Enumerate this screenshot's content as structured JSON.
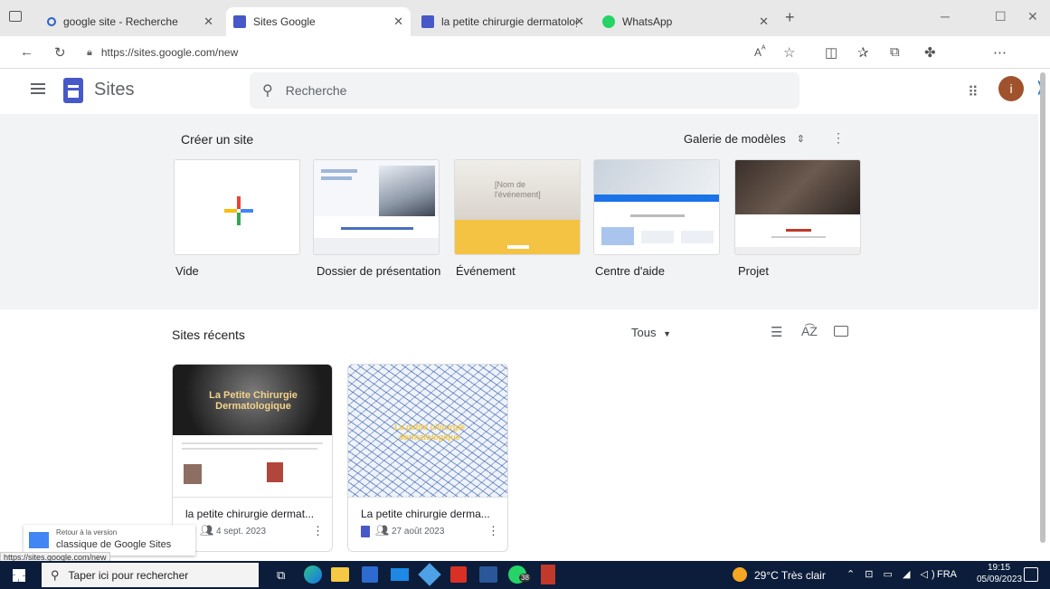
{
  "browser": {
    "tabs": [
      {
        "title": "google site - Recherche"
      },
      {
        "title": "Sites Google"
      },
      {
        "title": "la petite chirurgie dermatologiq"
      },
      {
        "title": "WhatsApp"
      }
    ],
    "url": "https://sites.google.com/new",
    "new_tab_label": "+"
  },
  "app": {
    "name": "Sites",
    "search_placeholder": "Recherche",
    "avatar_letter": "i"
  },
  "create": {
    "heading": "Créer un site",
    "gallery_label": "Galerie de modèles",
    "templates": [
      {
        "label": "Vide"
      },
      {
        "label": "Dossier de présentation"
      },
      {
        "label": "Événement",
        "thumb_text": "[Nom de l'événement]"
      },
      {
        "label": "Centre d'aide"
      },
      {
        "label": "Projet"
      }
    ]
  },
  "recent": {
    "heading": "Sites récents",
    "filter": "Tous",
    "sites": [
      {
        "title": "la petite chirurgie dermat...",
        "date": "4 sept. 2023",
        "banner": "La Petite Chirurgie Dermatologique"
      },
      {
        "title": "La petite chirurgie derma...",
        "date": "27 août 2023",
        "banner": "La petite chirurgie dermatologique"
      }
    ]
  },
  "classic": {
    "line1": "Retour à la version",
    "line2": "classique de Google Sites"
  },
  "status_url": "https://sites.google.com/new",
  "taskbar": {
    "search_placeholder": "Taper ici pour rechercher",
    "weather": "29°C Très clair",
    "lang": "FRA",
    "time": "19:15",
    "date": "05/09/2023",
    "whatsapp_badge": "38"
  },
  "colors": {
    "sites_blue": "#4758c8",
    "avatar_brown": "#a0522d",
    "taskbar_bg": "#0b1d3a"
  }
}
